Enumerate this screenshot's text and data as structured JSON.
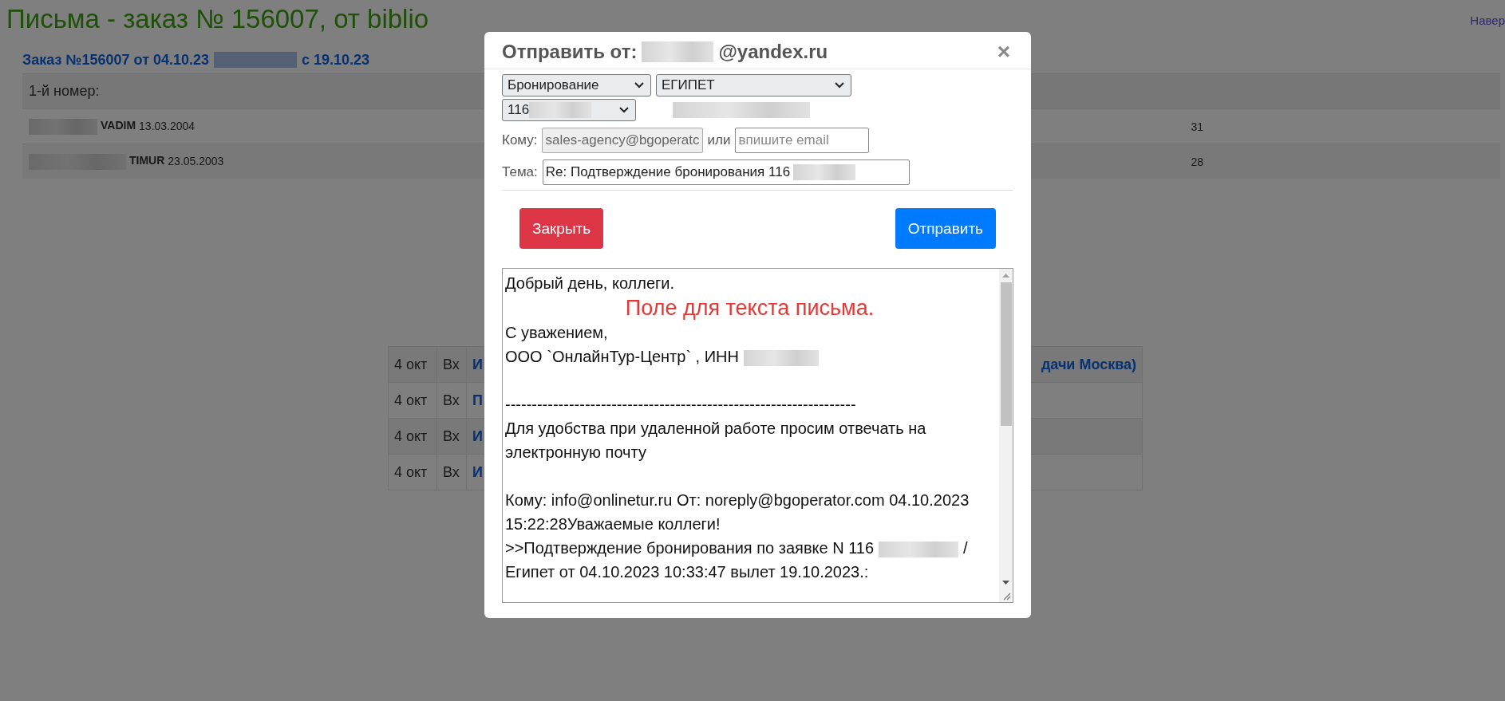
{
  "page": {
    "title": "Письма - заказ № 156007, от biblio",
    "top_link": "Навер",
    "order_heading": {
      "prefix": "Заказ №156007 от 04.10.23",
      "suffix": "с 19.10.23"
    }
  },
  "guests_table": {
    "header": "1-й номер:",
    "rows": [
      {
        "name": "VADIM",
        "birth_date": "13.03.2004",
        "column_3": "31"
      },
      {
        "name": "TIMUR",
        "birth_date": "23.05.2003",
        "column_3": "28"
      }
    ]
  },
  "letters_table": {
    "rows": [
      {
        "date": "4 окт",
        "direction": "Вх",
        "subject_start": "И",
        "subject_end": "дачи Москва)"
      },
      {
        "date": "4 окт",
        "direction": "Вх",
        "subject_start": "П"
      },
      {
        "date": "4 окт",
        "direction": "Вх",
        "subject_start": "И"
      },
      {
        "date": "4 окт",
        "direction": "Вх",
        "subject_start": "И"
      }
    ]
  },
  "dialog": {
    "title_prefix": "Отправить от:",
    "title_suffix": "@yandex.ru",
    "close": "×",
    "selects": [
      {
        "value": "Бронирование",
        "redacted": false
      },
      {
        "value": "ЕГИПЕТ",
        "redacted": false
      },
      {
        "value": "116",
        "redacted": true
      }
    ],
    "to_label": "Кому:",
    "to_value": "sales-agency@bgoperatc",
    "or_label": "или",
    "email_placeholder": "впишите email",
    "subject_label": "Тема:",
    "subject_value": "Re: Подтверждение бронирования 116",
    "buttons": [
      {
        "label": "Закрыть",
        "kind": "danger"
      },
      {
        "label": "Отправить",
        "kind": "primary"
      }
    ],
    "body_lines": [
      {
        "kind": "text",
        "text": "Добрый день, коллеги.",
        "redacted": false
      },
      {
        "kind": "annotation",
        "text": "Поле для текста письма."
      },
      {
        "kind": "text",
        "text": "С уважением,",
        "redacted": false
      },
      {
        "kind": "text",
        "text": "ООО `ОнлайнТур-Центр` , ИНН",
        "redacted": true
      },
      {
        "kind": "blank"
      },
      {
        "kind": "text",
        "text": "------------------------------------------------------------------",
        "redacted": false
      },
      {
        "kind": "text",
        "text": "Для удобства при удаленной работе просим отвечать на электронную почту",
        "redacted": false
      },
      {
        "kind": "blank"
      },
      {
        "kind": "text",
        "text": "Кому: info@onlinetur.ru От: noreply@bgoperator.com 04.10.2023 15:22:28Уважаемые коллеги!",
        "redacted": false
      },
      {
        "kind": "text",
        "text": ">>Подтверждение бронирования по заявке N 116",
        "redacted": true,
        "rest": "/"
      },
      {
        "kind": "text",
        "text": "Египет от 04.10.2023 10:33:47 вылет 19.10.2023.:",
        "redacted": false
      }
    ]
  }
}
